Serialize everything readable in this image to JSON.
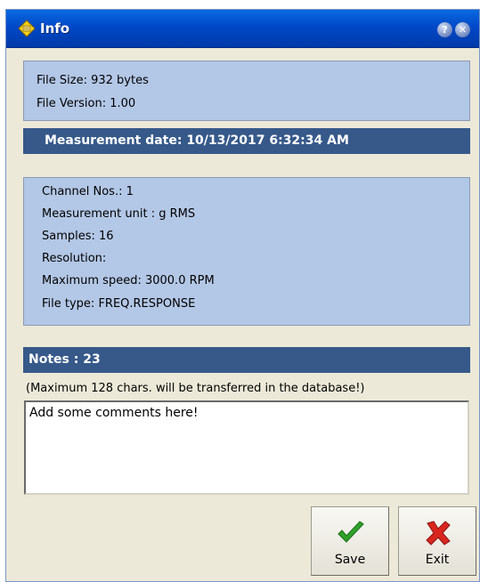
{
  "window": {
    "title": "Info",
    "help_glyph": "?",
    "close_glyph": "✕"
  },
  "file_info": {
    "size": "File Size: 932 bytes",
    "version": "File Version: 1.00"
  },
  "measurement": {
    "date_header": "Measurement date: 10/13/2017 6:32:34 AM",
    "channel": "Channel Nos.: 1",
    "unit": "Measurement unit : g RMS",
    "samples": "Samples: 16",
    "resolution": "Resolution:",
    "max_speed": "Maximum speed: 3000.0 RPM",
    "file_type": "File type: FREQ.RESPONSE"
  },
  "notes": {
    "header": "Notes : 23",
    "hint": "(Maximum 128 chars. will be transferred in the database!)",
    "value": "Add some comments here!"
  },
  "buttons": {
    "save_label": "Save",
    "exit_label": "Exit"
  },
  "icons": {
    "window_icon": "info-diamond-icon",
    "save_icon": "checkmark-icon",
    "exit_icon": "red-x-icon"
  },
  "colors": {
    "titlebar": "#0048c8",
    "panel": "#b3c7e6",
    "dark_header": "#36598a",
    "window_bg": "#ece9d8"
  }
}
